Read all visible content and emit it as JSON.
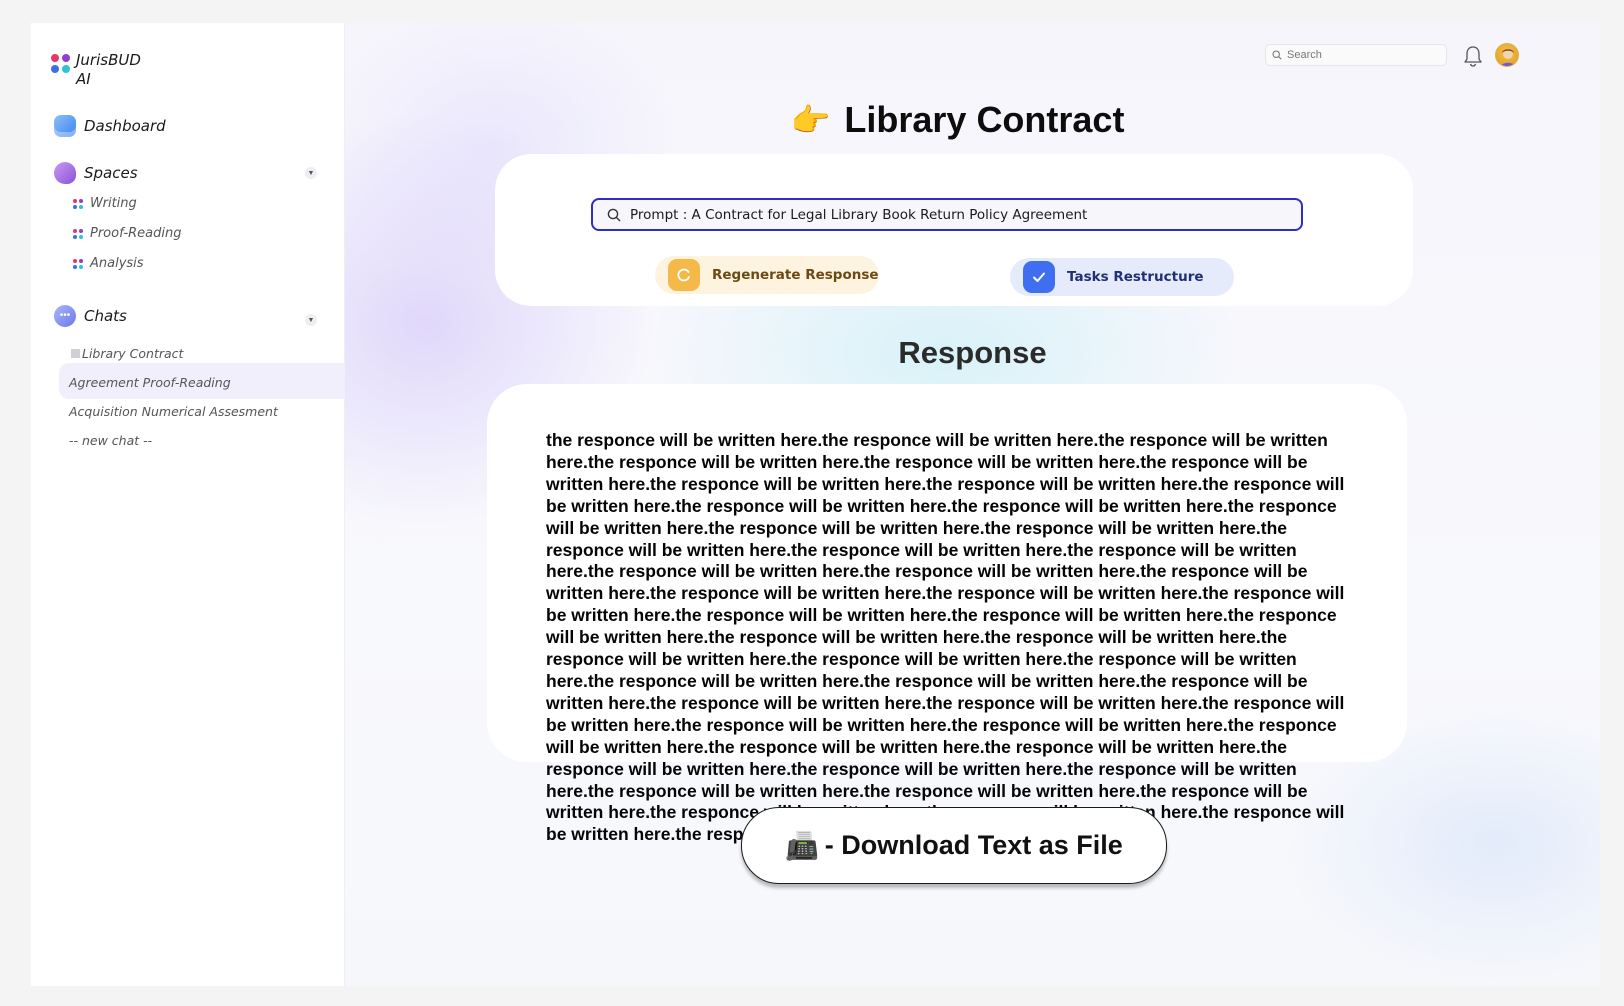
{
  "brand": {
    "name": "JurisBUD AI",
    "dot_colors": [
      "#e8356b",
      "#8b3fd6",
      "#3a6fe8",
      "#2ec4d6"
    ]
  },
  "sidebar": {
    "dashboard": {
      "label": "Dashboard",
      "icon": "dashboard-icon",
      "color": "#5b9cf5"
    },
    "spaces": {
      "label": "Spaces",
      "icon": "spaces-icon",
      "color": "#a36ee0",
      "items": [
        {
          "label": "Writing"
        },
        {
          "label": "Proof-Reading"
        },
        {
          "label": "Analysis"
        }
      ]
    },
    "chats": {
      "label": "Chats",
      "icon": "chats-icon",
      "color": "#7a8cf0",
      "items": [
        {
          "label": "Library Contract",
          "active": true
        },
        {
          "label": "Agreement Proof-Reading"
        },
        {
          "label": "Acquisition Numerical Assesment"
        },
        {
          "label": "-- new chat --"
        }
      ]
    }
  },
  "header": {
    "search_placeholder": "Search"
  },
  "main": {
    "title_emoji": "👉",
    "title": "Library Contract",
    "prompt_text": "Prompt : A Contract for Legal Library Book Return Policy Agreement",
    "regenerate_label": "Regenerate Response",
    "tasks_label": "Tasks Restructure",
    "response_heading": "Response",
    "response_text": "the responce will be written here.the responce will be written here.the responce will be written here.the responce will be written here.the responce will be written here.the responce will be written here.the responce will be written here.the responce will be written here.the responce will be written here.the responce will be written here.the responce will be written here.the responce will be written here.the responce will be written here.the responce will be written here.the responce will be written here.the responce will be written here.the responce will be written here.the responce will be written here.the responce will be written here.the responce will be written here.the responce will be written here.the responce will be written here.the responce will be written here.the responce will be written here.the responce will be written here.the responce will be written here.the responce will be written here.the responce will be written here.the responce will be written here.the responce will be written here.the responce will be written here.the responce will be written here.the responce will be written here.the responce will be written here.the responce will be written here.the responce will be written here.the responce will be written here.the responce will be written here.the responce will be written here.the responce will be written here.the responce will be written here.the responce will be written here.the responce will be written here.the responce will be written here.the responce will be written here.the responce will be written here.the responce will be written here.the responce will be written here.the responce will be written here.the responce will be written here.the responce will be written here.the responce will be written here........",
    "download_emoji": "📠",
    "download_label": "- Download Text as File"
  },
  "colors": {
    "accent_blue": "#2e2ec7",
    "regen_bg": "#fdf3df",
    "regen_icon": "#f5b94a",
    "tasks_bg": "#e6ebfb",
    "tasks_icon": "#3f6ff0"
  }
}
